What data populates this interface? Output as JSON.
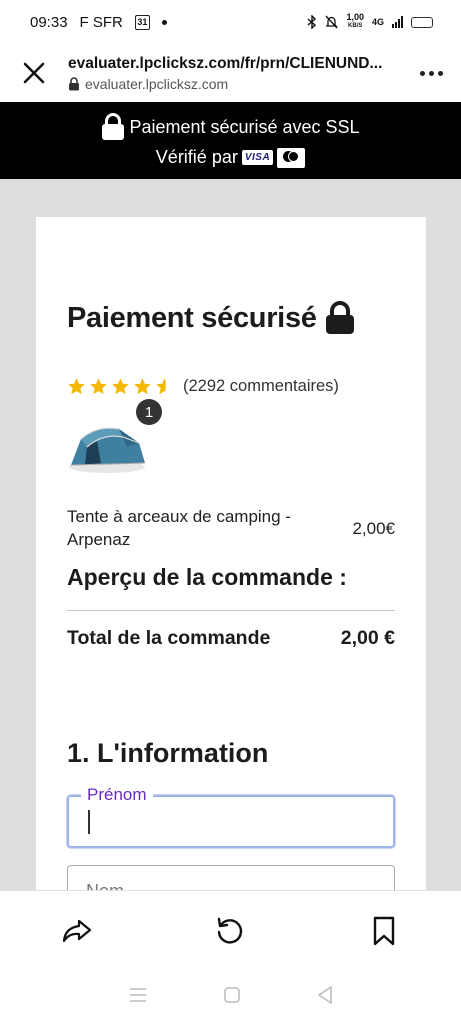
{
  "status_bar": {
    "time": "09:33",
    "carrier": "F SFR",
    "calendar_day": "31",
    "speed_value": "1,00",
    "speed_unit": "KB/S",
    "network": "4G"
  },
  "browser": {
    "page_title": "evaluater.lpclicksz.com/fr/prn/CLIENUND...",
    "host": "evaluater.lpclicksz.com"
  },
  "banner": {
    "line1": "Paiement sécurisé avec SSL",
    "line2": "Vérifié par",
    "visa": "VISA"
  },
  "checkout": {
    "title": "Paiement sécurisé",
    "rating_stars": 4.5,
    "reviews": "(2292 commentaires)",
    "quantity": "1",
    "product_name": "Tente à arceaux de camping - Arpenaz",
    "product_price": "2,00€",
    "overview_heading": "Aperçu de la commande :",
    "total_label": "Total de la commande",
    "total_value": "2,00 €",
    "section_heading": "1. L'information",
    "first_name_label": "Prénom",
    "first_name_value": "",
    "last_name_placeholder": "Nom"
  },
  "colors": {
    "banner_bg": "#000000",
    "star": "#f5b800",
    "focus_label": "#6a2bc2",
    "page_bg": "#dedede"
  }
}
